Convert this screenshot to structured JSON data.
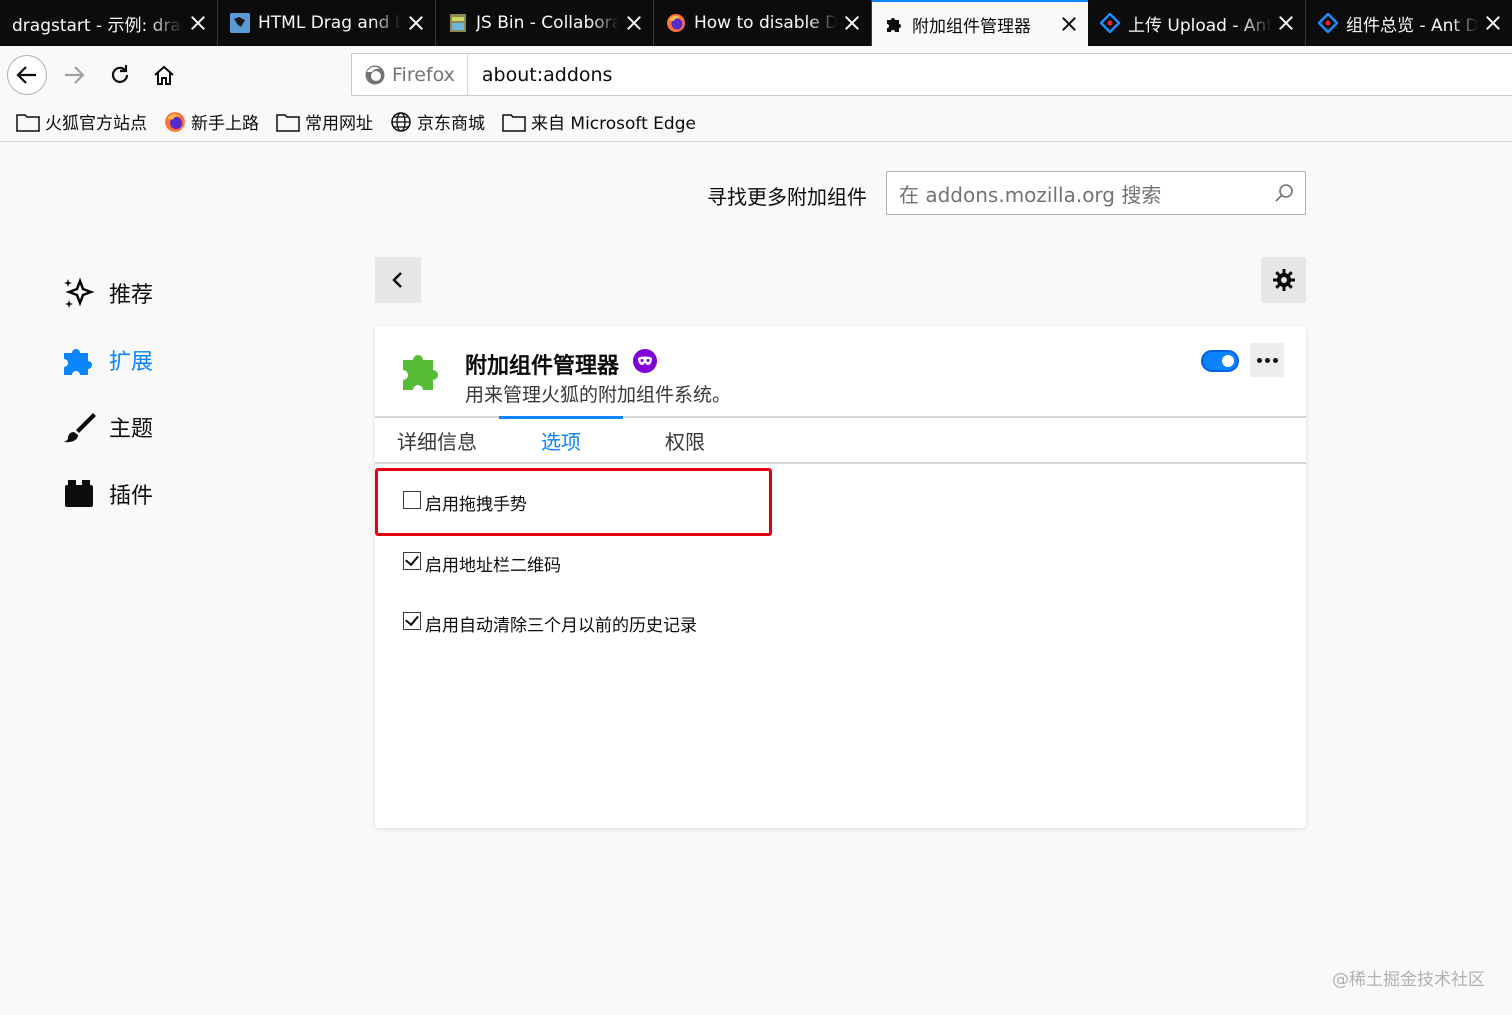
{
  "tabs": [
    {
      "title": "dragstart - 示例: dragst",
      "icon": "none",
      "active": false
    },
    {
      "title": "HTML Drag and Drop",
      "icon": "html-logo-icon",
      "active": false
    },
    {
      "title": "JS Bin - Collaborative",
      "icon": "jsbin-icon",
      "active": false
    },
    {
      "title": "How to disable Drag",
      "icon": "firefox-icon",
      "active": false
    },
    {
      "title": "附加组件管理器",
      "icon": "puzzle-icon",
      "active": true
    },
    {
      "title": "上传 Upload - Ant Design",
      "icon": "ant-design-icon",
      "active": false
    },
    {
      "title": "组件总览 - Ant Design",
      "icon": "ant-design-icon",
      "active": false
    }
  ],
  "urlbar": {
    "identity": "Firefox",
    "url": "about:addons"
  },
  "bookmarks": [
    {
      "label": "火狐官方站点",
      "icon": "folder-icon"
    },
    {
      "label": "新手上路",
      "icon": "firefox-icon"
    },
    {
      "label": "常用网址",
      "icon": "folder-icon"
    },
    {
      "label": "京东商城",
      "icon": "globe-icon"
    },
    {
      "label": "来自 Microsoft Edge",
      "icon": "folder-icon"
    }
  ],
  "search": {
    "label": "寻找更多附加组件",
    "placeholder": "在 addons.mozilla.org 搜索"
  },
  "categories": [
    {
      "label": "推荐",
      "icon": "sparkle-icon",
      "selected": false
    },
    {
      "label": "扩展",
      "icon": "puzzle-icon",
      "selected": true
    },
    {
      "label": "主题",
      "icon": "brush-icon",
      "selected": false
    },
    {
      "label": "插件",
      "icon": "plugin-icon",
      "selected": false
    }
  ],
  "addon": {
    "name": "附加组件管理器",
    "description": "用来管理火狐的附加组件系统。",
    "enabled": true,
    "private_browsing": true
  },
  "detail_tabs": [
    {
      "label": "详细信息",
      "active": false
    },
    {
      "label": "选项",
      "active": true
    },
    {
      "label": "权限",
      "active": false
    }
  ],
  "options": [
    {
      "label": "启用拖拽手势",
      "checked": false
    },
    {
      "label": "启用地址栏二维码",
      "checked": true
    },
    {
      "label": "启用自动清除三个月以前的历史记录",
      "checked": true
    }
  ],
  "colors": {
    "accent": "#0a84ff",
    "highlight": "#e60012",
    "tab_strip": "#0c0c0d"
  },
  "watermark": "@稀土掘金技术社区"
}
